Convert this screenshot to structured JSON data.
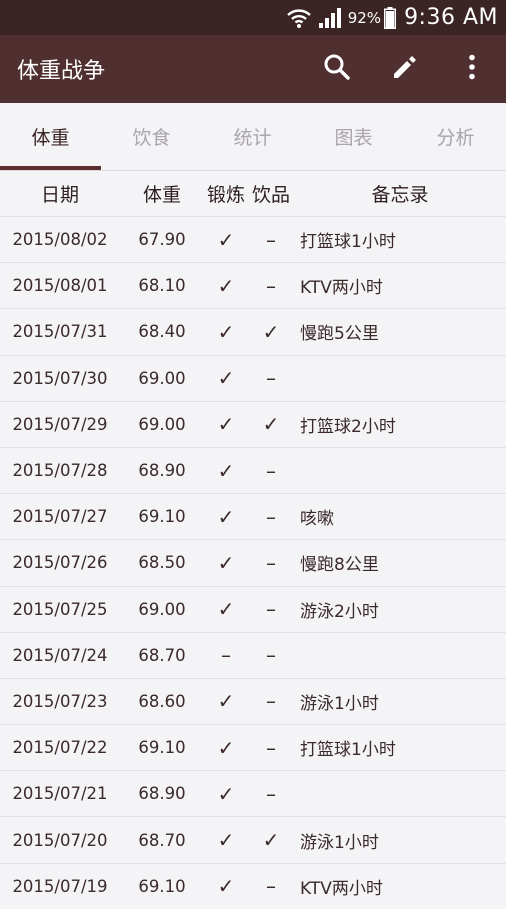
{
  "status": {
    "battery_percent": "92%",
    "time": "9:36 AM",
    "icons": [
      "wifi-icon",
      "signal-icon",
      "battery-icon"
    ]
  },
  "app_bar": {
    "title": "体重战争",
    "actions": [
      "search-icon",
      "edit-icon",
      "more-vert-icon"
    ]
  },
  "tabs": [
    {
      "label": "体重",
      "active": true
    },
    {
      "label": "饮食",
      "active": false
    },
    {
      "label": "统计",
      "active": false
    },
    {
      "label": "图表",
      "active": false
    },
    {
      "label": "分析",
      "active": false
    }
  ],
  "table": {
    "headers": {
      "date": "日期",
      "weight": "体重",
      "exercise": "锻炼",
      "drink": "饮品",
      "memo": "备忘录"
    },
    "rows": [
      {
        "date": "2015/08/02",
        "weight": "67.90",
        "exercise": "✓",
        "drink": "–",
        "memo": "打篮球1小时"
      },
      {
        "date": "2015/08/01",
        "weight": "68.10",
        "exercise": "✓",
        "drink": "–",
        "memo": "KTV两小时"
      },
      {
        "date": "2015/07/31",
        "weight": "68.40",
        "exercise": "✓",
        "drink": "✓",
        "memo": "慢跑5公里"
      },
      {
        "date": "2015/07/30",
        "weight": "69.00",
        "exercise": "✓",
        "drink": "–",
        "memo": ""
      },
      {
        "date": "2015/07/29",
        "weight": "69.00",
        "exercise": "✓",
        "drink": "✓",
        "memo": "打篮球2小时"
      },
      {
        "date": "2015/07/28",
        "weight": "68.90",
        "exercise": "✓",
        "drink": "–",
        "memo": ""
      },
      {
        "date": "2015/07/27",
        "weight": "69.10",
        "exercise": "✓",
        "drink": "–",
        "memo": "咳嗽"
      },
      {
        "date": "2015/07/26",
        "weight": "68.50",
        "exercise": "✓",
        "drink": "–",
        "memo": "慢跑8公里"
      },
      {
        "date": "2015/07/25",
        "weight": "69.00",
        "exercise": "✓",
        "drink": "–",
        "memo": "游泳2小时"
      },
      {
        "date": "2015/07/24",
        "weight": "68.70",
        "exercise": "–",
        "drink": "–",
        "memo": ""
      },
      {
        "date": "2015/07/23",
        "weight": "68.60",
        "exercise": "✓",
        "drink": "–",
        "memo": "游泳1小时"
      },
      {
        "date": "2015/07/22",
        "weight": "69.10",
        "exercise": "✓",
        "drink": "–",
        "memo": "打篮球1小时"
      },
      {
        "date": "2015/07/21",
        "weight": "68.90",
        "exercise": "✓",
        "drink": "–",
        "memo": ""
      },
      {
        "date": "2015/07/20",
        "weight": "68.70",
        "exercise": "✓",
        "drink": "✓",
        "memo": "游泳1小时"
      },
      {
        "date": "2015/07/19",
        "weight": "69.10",
        "exercise": "✓",
        "drink": "–",
        "memo": "KTV两小时"
      }
    ]
  },
  "colors": {
    "status_bar": "#3a2424",
    "app_bar": "#4f2f30",
    "accent": "#5a2d2e",
    "background": "#f4f3f6"
  }
}
